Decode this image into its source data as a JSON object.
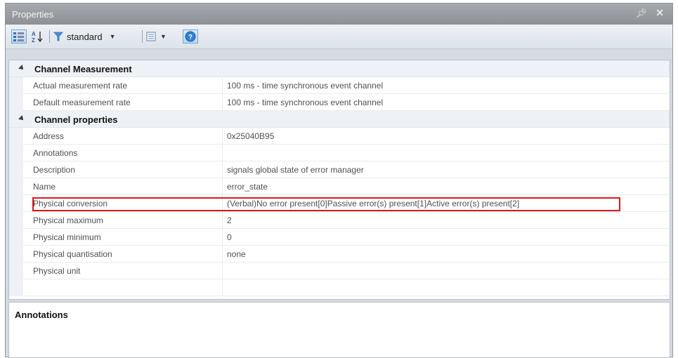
{
  "window": {
    "title": "Properties",
    "pin_glyph": "ᵖ",
    "close_glyph": "✕"
  },
  "toolbar": {
    "filter_label": "standard"
  },
  "grid": {
    "categories": [
      {
        "label": "Channel Measurement",
        "rows": [
          {
            "name": "Actual measurement rate",
            "value": "100 ms - time synchronous event channel"
          },
          {
            "name": "Default measurement rate",
            "value": "100 ms - time synchronous event channel"
          }
        ]
      },
      {
        "label": "Channel properties",
        "rows": [
          {
            "name": "Address",
            "value": "0x25040B95"
          },
          {
            "name": "Annotations",
            "value": ""
          },
          {
            "name": "Description",
            "value": "signals global state of error manager"
          },
          {
            "name": "Name",
            "value": "error_state"
          },
          {
            "name": "Physical conversion",
            "value": "(Verbal)No error present[0]Passive error(s) present[1]Active error(s) present[2]"
          },
          {
            "name": "Physical maximum",
            "value": "2"
          },
          {
            "name": "Physical minimum",
            "value": "0"
          },
          {
            "name": "Physical quantisation",
            "value": "none"
          },
          {
            "name": "Physical unit",
            "value": ""
          }
        ]
      }
    ]
  },
  "annotations_panel": {
    "heading": "Annotations"
  },
  "colors": {
    "highlight": "#e01818",
    "accent": "#2d7fd1"
  }
}
